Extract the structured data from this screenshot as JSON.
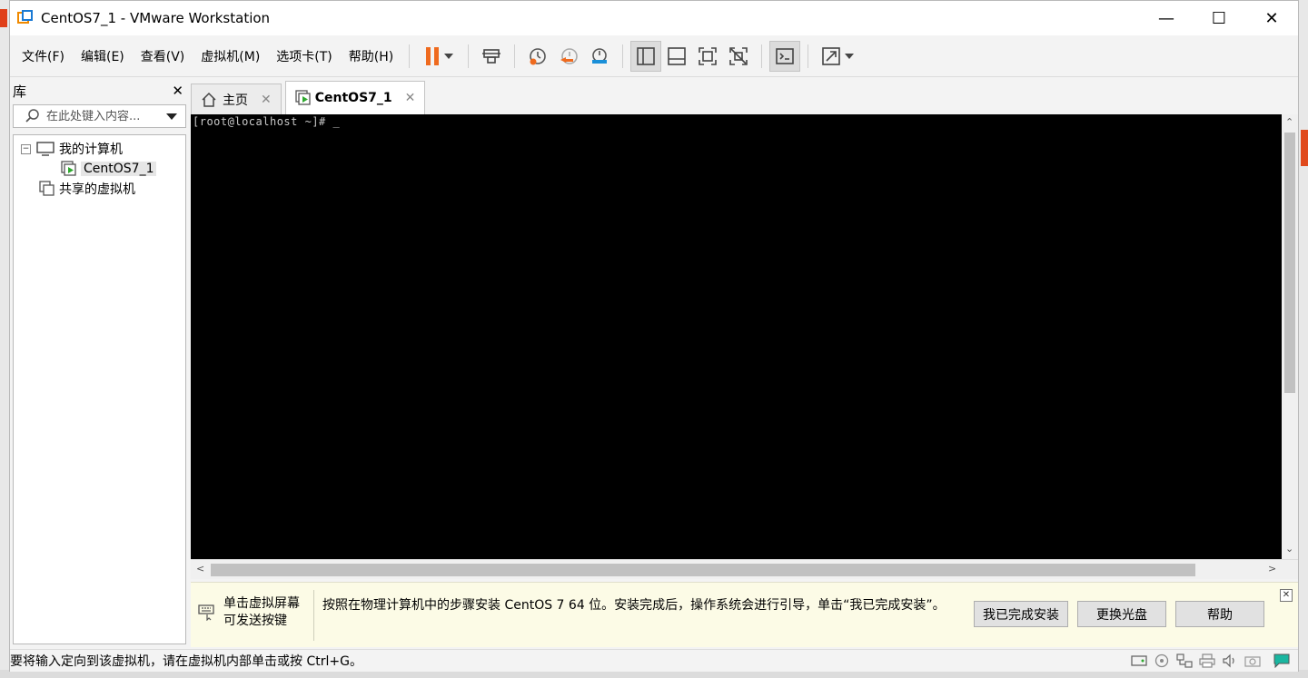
{
  "window": {
    "title": "CentOS7_1 - VMware Workstation",
    "controls": {
      "minimize": "—",
      "maximize": "☐",
      "close": "✕"
    }
  },
  "menu": [
    {
      "label": "文件(F)"
    },
    {
      "label": "编辑(E)"
    },
    {
      "label": "查看(V)"
    },
    {
      "label": "虚拟机(M)"
    },
    {
      "label": "选项卡(T)"
    },
    {
      "label": "帮助(H)"
    }
  ],
  "library": {
    "title": "库",
    "close": "✕",
    "search_placeholder": "在此处键入内容...",
    "tree": {
      "my_computer": "我的计算机",
      "vm": "CentOS7_1",
      "shared": "共享的虚拟机",
      "collapse_symbol": "−"
    }
  },
  "tabs": [
    {
      "label": "主页",
      "close": "✕"
    },
    {
      "label": "CentOS7_1",
      "close": "✕"
    }
  ],
  "console": {
    "line": "[root@localhost ~]# _"
  },
  "infobar": {
    "hint": "单击虚拟屏幕\n可发送按键",
    "message": "按照在物理计算机中的步骤安装 CentOS 7 64 位。安装完成后，操作系统会进行引导，单击“我已完成安装”。",
    "buttons": {
      "done": "我已完成安装",
      "change_disc": "更换光盘",
      "help": "帮助"
    },
    "close": "✕"
  },
  "status": {
    "text": "要将输入定向到该虚拟机，请在虚拟机内部单击或按 Ctrl+G。"
  },
  "colors": {
    "accent": "#ef6a1e",
    "console_bg": "#000000",
    "infobar_bg": "#fcfbe6"
  }
}
